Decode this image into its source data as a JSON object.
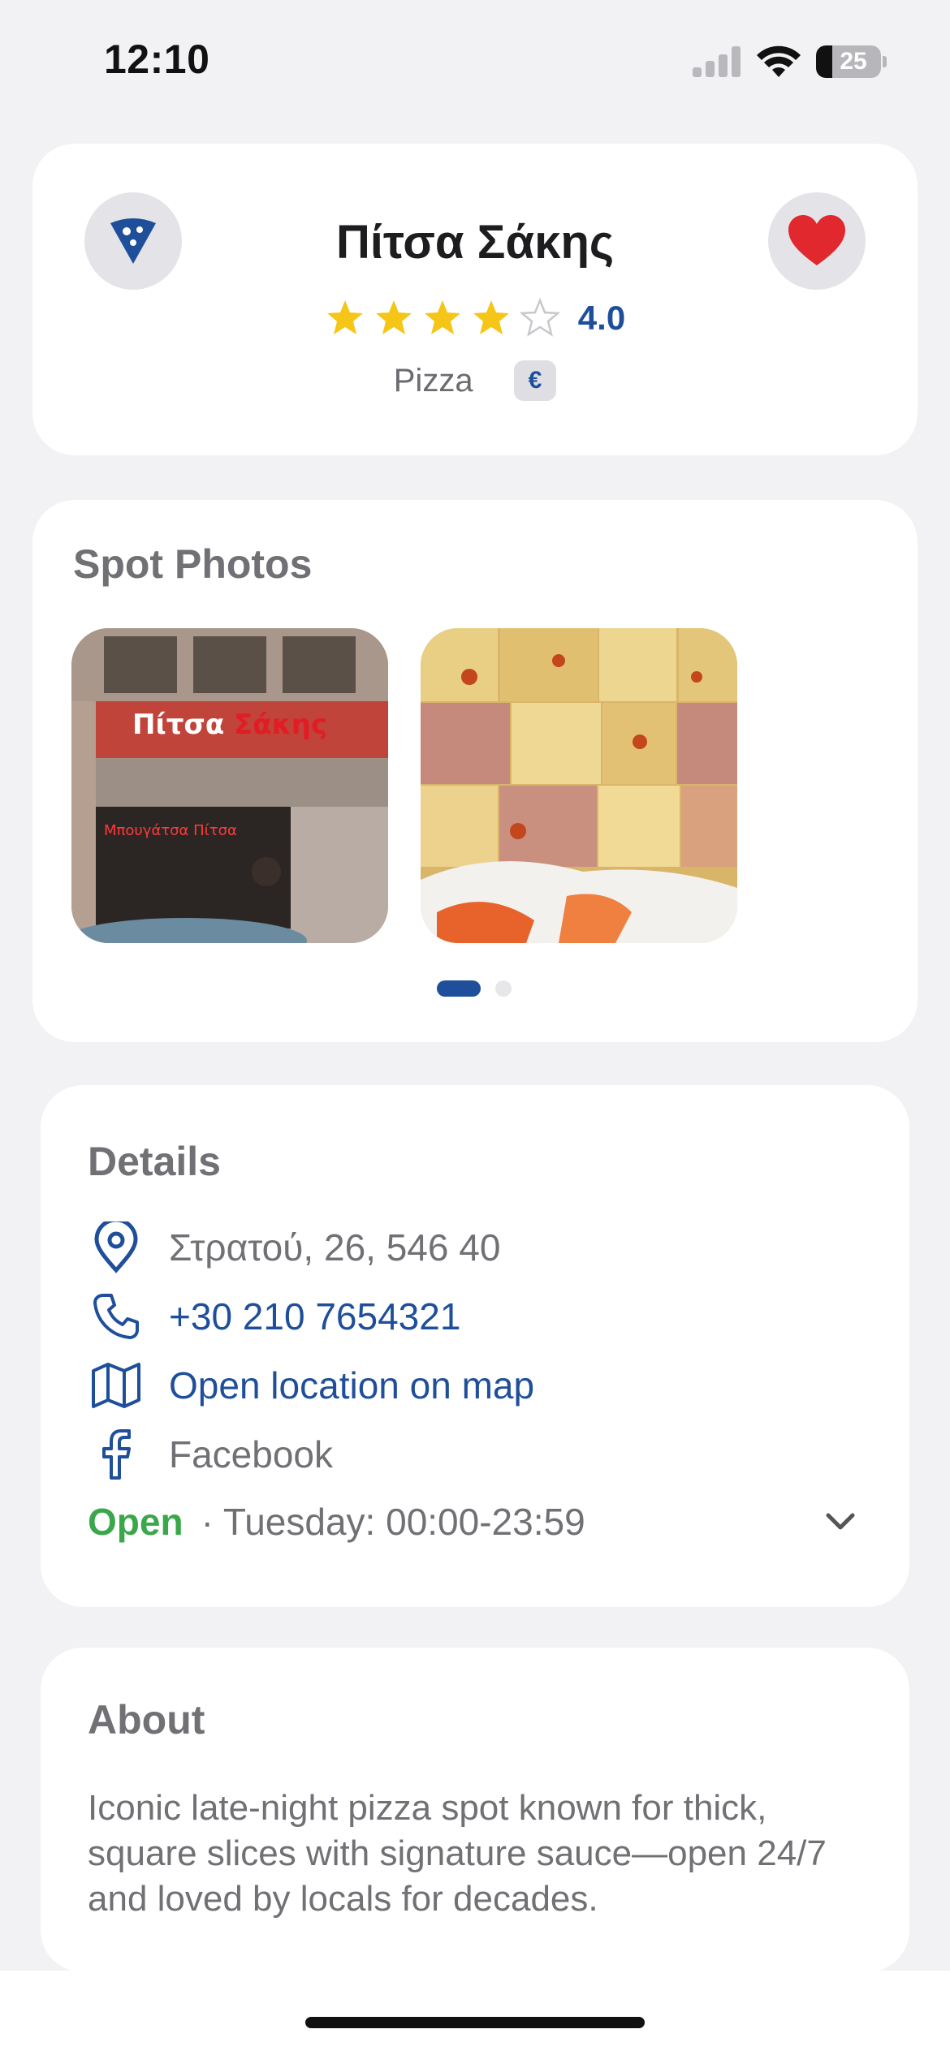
{
  "status_bar": {
    "time": "12:10",
    "battery_level": "25",
    "icons": [
      "cellular-signal-icon",
      "wifi-icon",
      "battery-icon"
    ]
  },
  "header": {
    "title": "Πίτσα Σάκης",
    "rating": 4,
    "rating_max": 5,
    "rating_text": "4.0",
    "category": "Pizza",
    "price_level": "€",
    "left_button_icon": "pizza-slice-icon",
    "right_button_icon": "heart-icon"
  },
  "photos": {
    "title": "Spot Photos",
    "items": [
      "storefront-photo",
      "pizza-slices-photo"
    ],
    "page_count": 2,
    "active_page": 1
  },
  "details": {
    "title": "Details",
    "address": "Στρατού, 26, 546 40",
    "phone": "+30 210 7654321",
    "map_link": "Open location on map",
    "facebook": "Facebook",
    "open_status": "Open",
    "hours": "· Tuesday: 00:00-23:59"
  },
  "about": {
    "title": "About",
    "text": "Iconic late-night pizza spot known for thick, square slices with signature sauce—open 24/7 and loved by locals for decades."
  },
  "colors": {
    "accent": "#1f4f9a",
    "open": "#3aa84a",
    "heart": "#e0282e",
    "star": "#f5c518",
    "background": "#f2f2f5"
  }
}
